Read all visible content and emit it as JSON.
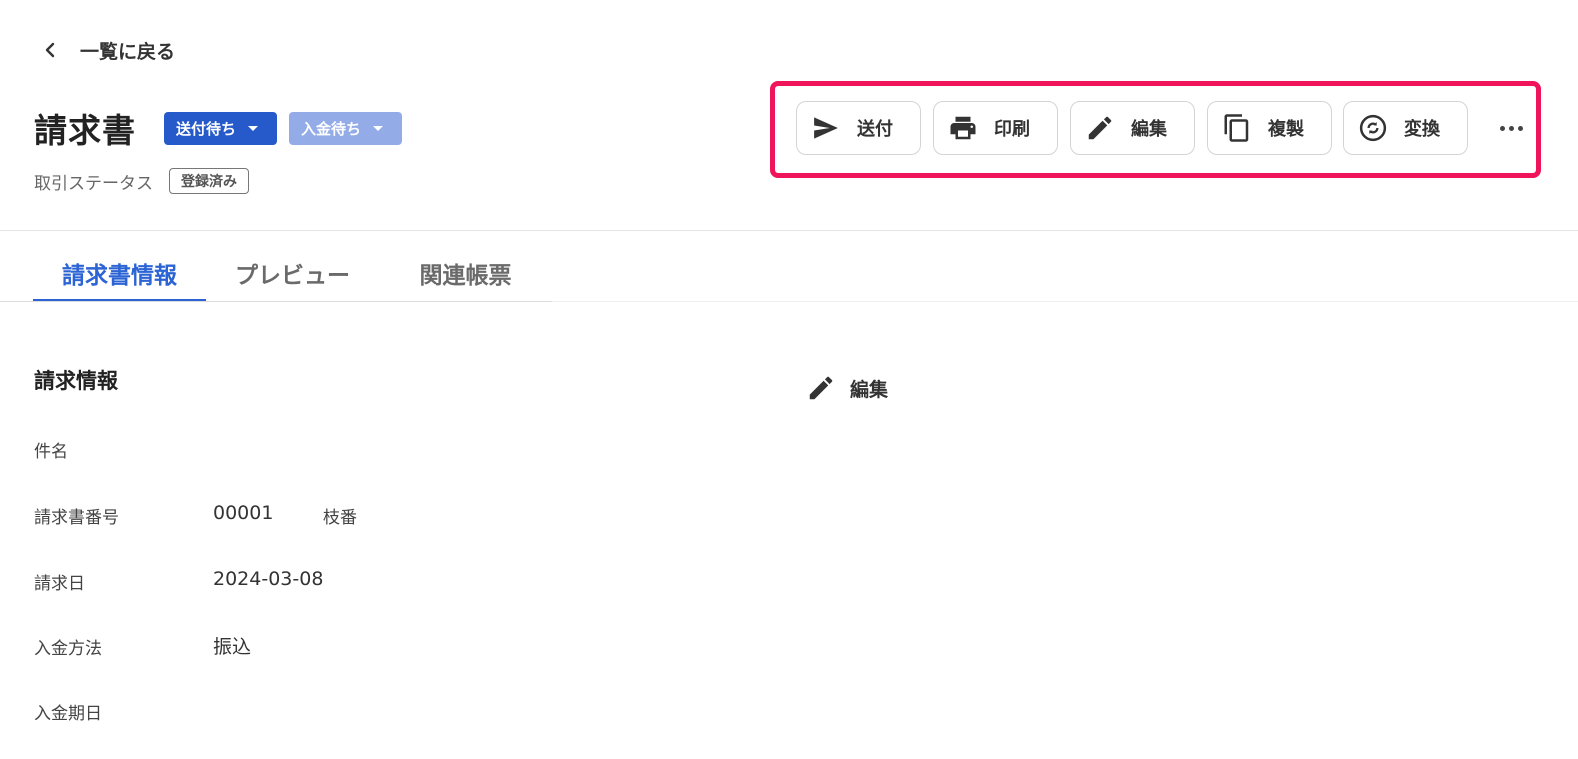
{
  "header": {
    "back_label": "一覧に戻る",
    "title": "請求書",
    "send_status": "送付待ち",
    "payment_status": "入金待ち",
    "transaction_status_label": "取引ステータス",
    "transaction_status_value": "登録済み"
  },
  "toolbar": {
    "send": "送付",
    "print": "印刷",
    "edit": "編集",
    "duplicate": "複製",
    "convert": "変換"
  },
  "tabs": {
    "info": "請求書情報",
    "preview": "プレビュー",
    "related": "関連帳票"
  },
  "section": {
    "title": "請求情報",
    "edit_label": "編集"
  },
  "fields": {
    "subject_label": "件名",
    "subject_value": "",
    "invoice_number_label": "請求書番号",
    "invoice_number_value": "00001",
    "branch_label": "枝番",
    "invoice_date_label": "請求日",
    "invoice_date_value": "2024-03-08",
    "payment_method_label": "入金方法",
    "payment_method_value": "振込",
    "payment_due_label": "入金期日",
    "payment_due_value": ""
  },
  "colors": {
    "accent": "#2d64d4",
    "send_badge": "#2659c9",
    "pay_badge": "#93abe6",
    "highlight": "#f0145a"
  },
  "icons": [
    "chevron-left-icon",
    "send-icon",
    "print-icon",
    "edit-icon",
    "copy-icon",
    "convert-icon",
    "more-icon"
  ]
}
